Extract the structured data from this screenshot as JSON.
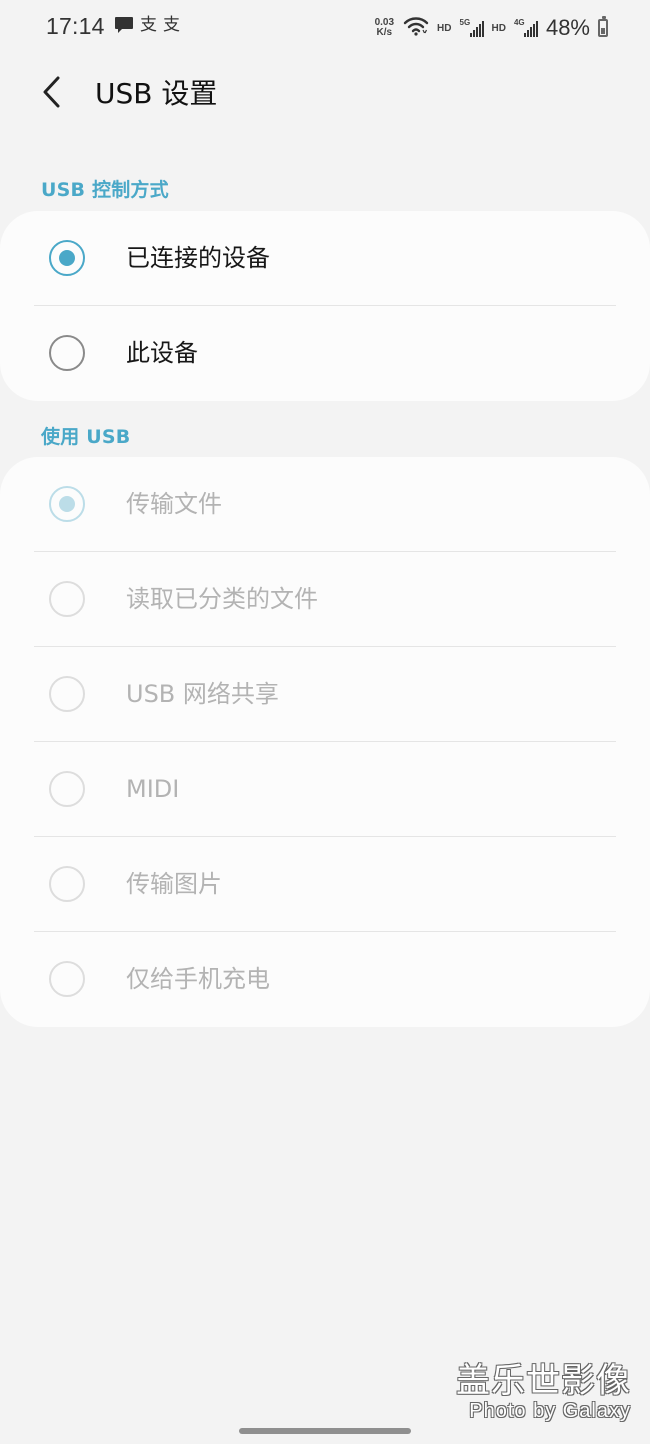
{
  "status_bar": {
    "time": "17:14",
    "left_icons": [
      "message-icon",
      "app-icon",
      "app-icon"
    ],
    "left_texts": [
      "支",
      "支"
    ],
    "network_speed": {
      "value": "0.03",
      "unit": "K/s"
    },
    "wifi_icon": "wifi-icon",
    "hd_labels": [
      "HD",
      "HD"
    ],
    "network_types": [
      "5G",
      "4G"
    ],
    "battery_percent": "48%",
    "battery_level": 0.48
  },
  "header": {
    "back_icon": "chevron-left-icon",
    "title": "USB 设置"
  },
  "sections": [
    {
      "title": "USB 控制方式",
      "options": [
        {
          "label": "已连接的设备",
          "selected": true
        },
        {
          "label": "此设备",
          "selected": false
        }
      ]
    },
    {
      "title": "使用 USB",
      "disabled": true,
      "options": [
        {
          "label": "传输文件",
          "selected": true
        },
        {
          "label": "读取已分类的文件",
          "selected": false
        },
        {
          "label": "USB 网络共享",
          "selected": false
        },
        {
          "label": "MIDI",
          "selected": false
        },
        {
          "label": "传输图片",
          "selected": false
        },
        {
          "label": "仅给手机充电",
          "selected": false
        }
      ]
    }
  ],
  "watermark": {
    "line1": "盖乐世影像",
    "line2": "Photo by Galaxy"
  },
  "colors": {
    "accent": "#4aa8c8",
    "background": "#f3f3f3",
    "card": "#fcfcfc",
    "disabled_text": "#b3b3b3"
  }
}
